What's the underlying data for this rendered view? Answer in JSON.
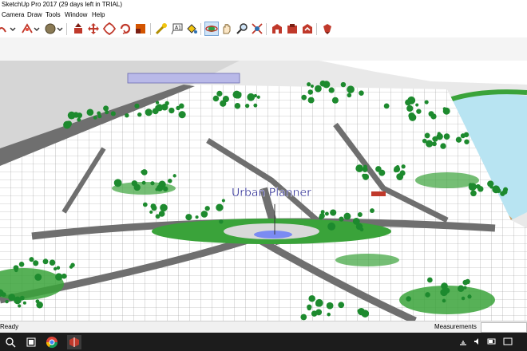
{
  "window": {
    "title": "SketchUp Pro 2017 (29 days left in TRIAL)"
  },
  "menu": [
    "Camera",
    "Draw",
    "Tools",
    "Window",
    "Help"
  ],
  "model": {
    "label": "Urban Planner"
  },
  "status": {
    "ready": "Ready",
    "measurements_label": "Measurements"
  },
  "colors": {
    "grass": "#3aa33a",
    "road": "#6f6f6f",
    "water": "#b8e4f2",
    "building": "#ffffff",
    "tree": "#1d8a2e",
    "label_text": "#1a1a8c"
  },
  "toolbar_icons": [
    "arc-icon",
    "shapes-icon",
    "material-icon",
    "push-pull-icon",
    "move-icon",
    "rotate-icon",
    "scale-icon",
    "offset-icon",
    "tape-measure-icon",
    "text-icon",
    "paint-bucket-icon",
    "orbit-icon",
    "pan-icon",
    "zoom-icon",
    "zoom-extents-icon",
    "warehouse-icon",
    "extension-warehouse-icon",
    "share-model-icon",
    "ruby-icon"
  ],
  "taskbar_icons": [
    "search-icon",
    "task-view-icon",
    "mail-icon",
    "chrome-icon",
    "sketchup-icon"
  ]
}
